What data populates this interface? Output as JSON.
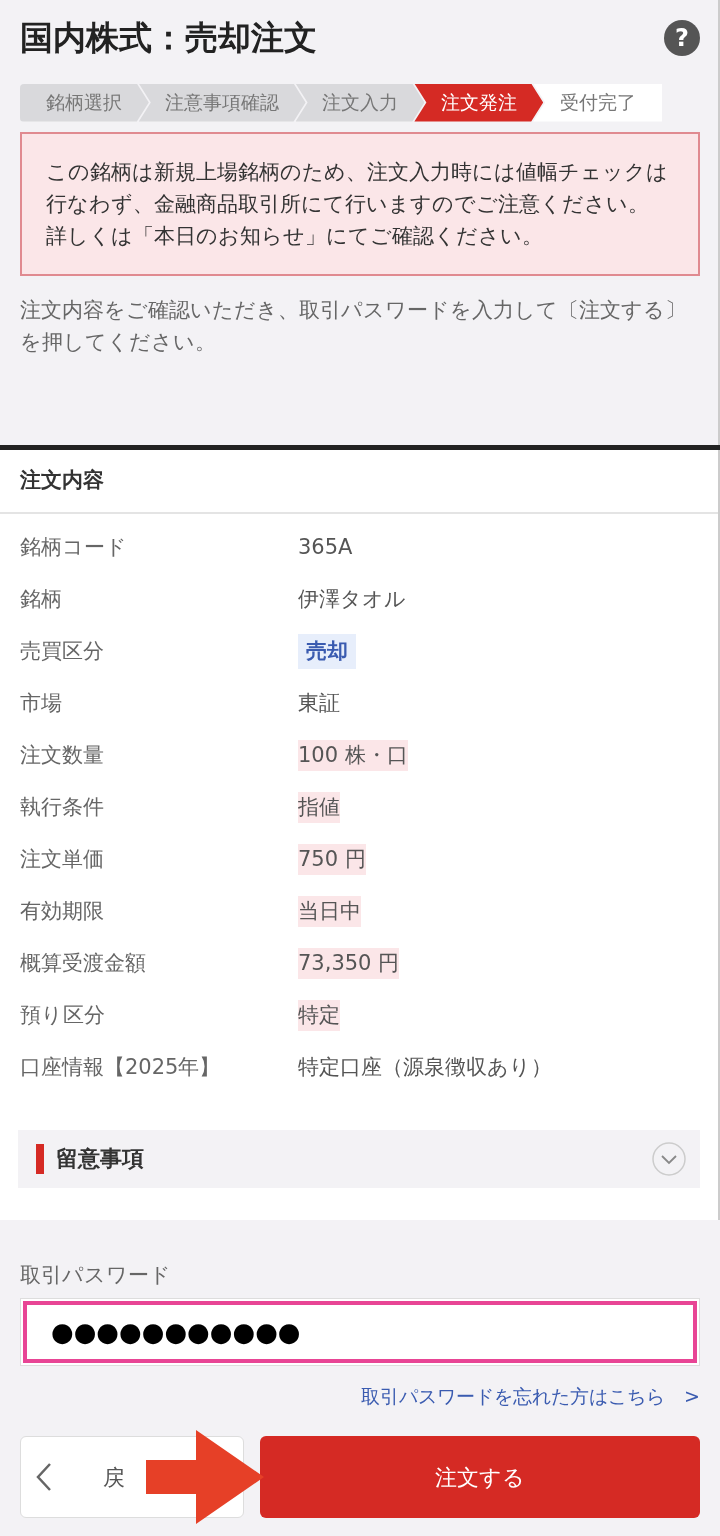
{
  "header": {
    "title": "国内株式：売却注文",
    "help_icon": "?"
  },
  "steps": [
    {
      "label": "銘柄選択",
      "selected": false
    },
    {
      "label": "注意事項確認",
      "selected": false
    },
    {
      "label": "注文入力",
      "selected": false
    },
    {
      "label": "注文発注",
      "selected": true
    },
    {
      "label": "受付完了",
      "selected": false
    }
  ],
  "alert": {
    "lines": [
      "この銘柄は新規上場銘柄のため、注文入力時には値幅チェックは行なわず、金融商品取引所にて行いますのでご注意ください。",
      "詳しくは「本日のお知らせ」にてご確認ください。"
    ]
  },
  "instruction": "注文内容をご確認いただき、取引パスワードを入力して〔注文する〕を押してください。",
  "order": {
    "title": "注文内容",
    "rows": [
      {
        "label": "銘柄コード",
        "value": "365A",
        "kind": "plain"
      },
      {
        "label": "銘柄",
        "value": "伊澤タオル",
        "kind": "plain"
      },
      {
        "label": "売買区分",
        "value": "売却",
        "kind": "tag"
      },
      {
        "label": "市場",
        "value": "東証",
        "kind": "plain"
      },
      {
        "label": "注文数量",
        "value": "100 株・口",
        "kind": "marked"
      },
      {
        "label": "執行条件",
        "value": "指値",
        "kind": "marked"
      },
      {
        "label": "注文単価",
        "value": "750 円",
        "kind": "marked"
      },
      {
        "label": "有効期限",
        "value": "当日中",
        "kind": "marked"
      },
      {
        "label": "概算受渡金額",
        "value": "73,350 円",
        "kind": "marked"
      },
      {
        "label": "預り区分",
        "value": "特定",
        "kind": "marked"
      },
      {
        "label": "口座情報【2025年】",
        "value": "特定口座（源泉徴収あり）",
        "kind": "plain"
      }
    ]
  },
  "notes": {
    "title": "留意事項",
    "expanded": false
  },
  "password": {
    "label": "取引パスワード",
    "value": "●●●●●●●●●●●",
    "forgot_link": "取引パスワードを忘れた方はこちら",
    "link_arrow": ">"
  },
  "buttons": {
    "back": {
      "label": "戻"
    },
    "submit": {
      "label": "注文する"
    }
  }
}
